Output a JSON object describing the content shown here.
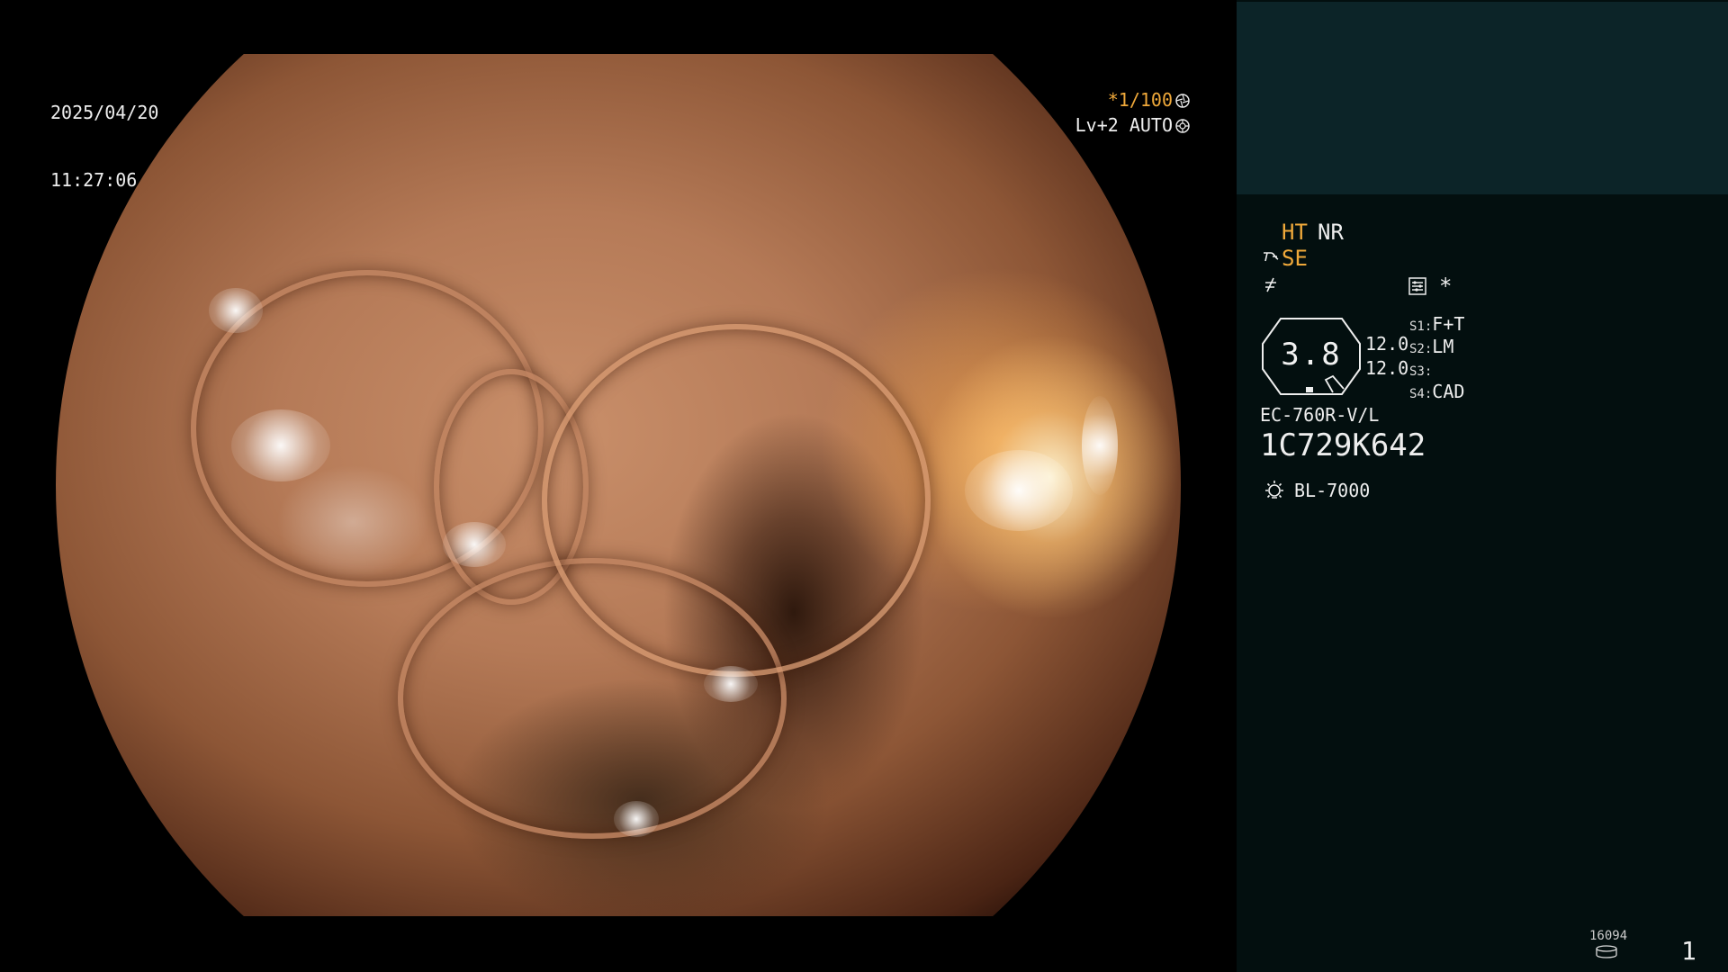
{
  "overlay": {
    "date": "2025/04/20",
    "time": "11:27:06",
    "shutter": "*1/100",
    "exposure": "Lv+2 AUTO"
  },
  "panel": {
    "mode_ht": "HT",
    "mode_nr": "NR",
    "mode_se": "SE",
    "star": "*",
    "zoom": "3.8",
    "level_1": "12.0",
    "level_2": "12.0",
    "slots": [
      {
        "key": "S1:",
        "value": "F+T"
      },
      {
        "key": "S2:",
        "value": "LM"
      },
      {
        "key": "S3:",
        "value": ""
      },
      {
        "key": "S4:",
        "value": "CAD"
      }
    ],
    "scope_model": "EC-760R-V/L",
    "scope_serial": "1C729K642",
    "light_source": "BL-7000",
    "counter": "16094",
    "page_number": "1"
  },
  "colors": {
    "accent": "#f0a93a",
    "text": "#eeeeee",
    "panel_bg": "#030f0f",
    "thumb_bg": "#0c2428"
  },
  "icons": {
    "shutter": "aperture-icon",
    "exposure": "iris-icon",
    "se": "scope-tip-icon",
    "freeze": "freeze-icon",
    "memo": "memo-icon",
    "light": "light-bulb-icon",
    "storage": "storage-icon"
  }
}
